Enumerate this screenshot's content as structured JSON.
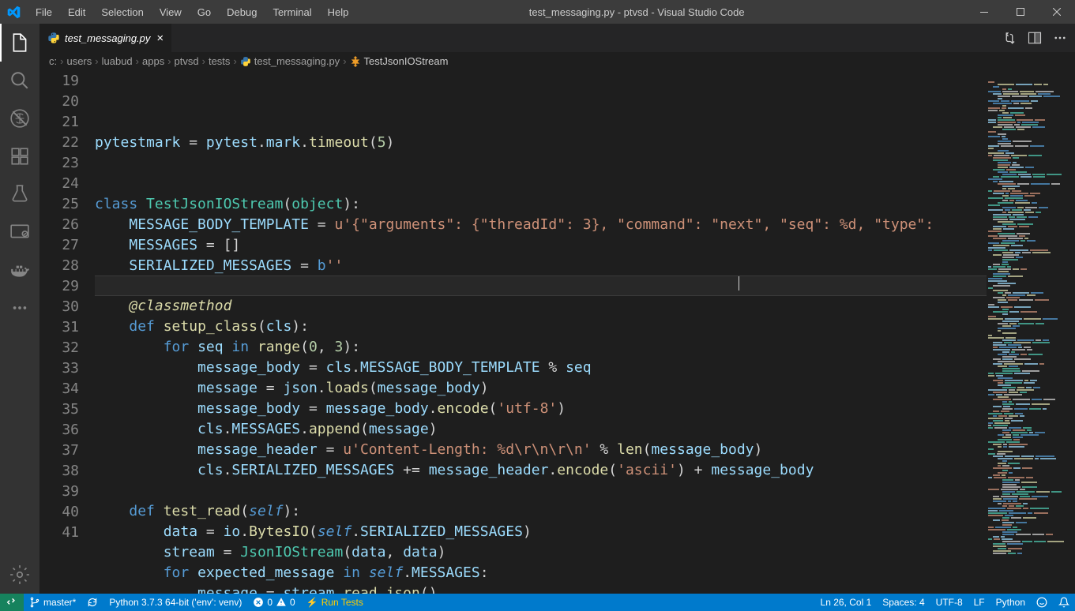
{
  "window": {
    "title": "test_messaging.py - ptvsd - Visual Studio Code"
  },
  "menu": [
    "File",
    "Edit",
    "Selection",
    "View",
    "Go",
    "Debug",
    "Terminal",
    "Help"
  ],
  "tab": {
    "filename": "test_messaging.py"
  },
  "breadcrumbs": [
    {
      "label": "c:"
    },
    {
      "label": "users"
    },
    {
      "label": "luabud"
    },
    {
      "label": "apps"
    },
    {
      "label": "ptvsd"
    },
    {
      "label": "tests"
    },
    {
      "label": "test_messaging.py",
      "icon": "python"
    },
    {
      "label": "TestJsonIOStream",
      "icon": "class"
    }
  ],
  "editor": {
    "lines": [
      {
        "n": 19,
        "html": "<span class='var'>pytestmark</span> <span class='op'>=</span> <span class='var'>pytest</span>.<span class='var'>mark</span>.<span class='fn'>timeout</span>(<span class='num'>5</span>)"
      },
      {
        "n": 20,
        "html": ""
      },
      {
        "n": 21,
        "html": ""
      },
      {
        "n": 22,
        "html": "<span class='kw'>class</span> <span class='cls'>TestJsonIOStream</span>(<span class='cls'>object</span>):"
      },
      {
        "n": 23,
        "html": "    <span class='var'>MESSAGE_BODY_TEMPLATE</span> <span class='op'>=</span> <span class='str'>u'{\"arguments\": {\"threadId\": 3}, \"command\": \"next\", \"seq\": %d, \"type\":</span>"
      },
      {
        "n": 24,
        "html": "    <span class='var'>MESSAGES</span> <span class='op'>=</span> []"
      },
      {
        "n": 25,
        "html": "    <span class='var'>SERIALIZED_MESSAGES</span> <span class='op'>=</span> <span class='kw'>b</span><span class='str'>''</span>"
      },
      {
        "n": 26,
        "html": "",
        "current": true
      },
      {
        "n": 27,
        "html": "    <span class='bfn'>@classmethod</span>"
      },
      {
        "n": 28,
        "html": "    <span class='kw'>def</span> <span class='fn'>setup_class</span>(<span class='var'>cls</span>):"
      },
      {
        "n": 29,
        "html": "        <span class='kw'>for</span> <span class='var'>seq</span> <span class='kw'>in</span> <span class='fn'>range</span>(<span class='num'>0</span>, <span class='num'>3</span>):"
      },
      {
        "n": 30,
        "html": "            <span class='var'>message_body</span> <span class='op'>=</span> <span class='var'>cls</span>.<span class='var'>MESSAGE_BODY_TEMPLATE</span> <span class='op'>%</span> <span class='var'>seq</span>"
      },
      {
        "n": 31,
        "html": "            <span class='var'>message</span> <span class='op'>=</span> <span class='var'>json</span>.<span class='fn'>loads</span>(<span class='var'>message_body</span>)"
      },
      {
        "n": 32,
        "html": "            <span class='var'>message_body</span> <span class='op'>=</span> <span class='var'>message_body</span>.<span class='fn'>encode</span>(<span class='str'>'utf-8'</span>)"
      },
      {
        "n": 33,
        "html": "            <span class='var'>cls</span>.<span class='var'>MESSAGES</span>.<span class='fn'>append</span>(<span class='var'>message</span>)"
      },
      {
        "n": 34,
        "html": "            <span class='var'>message_header</span> <span class='op'>=</span> <span class='str'>u'Content-Length: %d\\r\\n\\r\\n'</span> <span class='op'>%</span> <span class='fn'>len</span>(<span class='var'>message_body</span>)"
      },
      {
        "n": 35,
        "html": "            <span class='var'>cls</span>.<span class='var'>SERIALIZED_MESSAGES</span> <span class='op'>+=</span> <span class='var'>message_header</span>.<span class='fn'>encode</span>(<span class='str'>'ascii'</span>) <span class='op'>+</span> <span class='var'>message_body</span>"
      },
      {
        "n": 36,
        "html": ""
      },
      {
        "n": 37,
        "html": "    <span class='kw'>def</span> <span class='fn'>test_read</span>(<span class='self'>self</span>):"
      },
      {
        "n": 38,
        "html": "        <span class='var'>data</span> <span class='op'>=</span> <span class='var'>io</span>.<span class='fn'>BytesIO</span>(<span class='self'>self</span>.<span class='var'>SERIALIZED_MESSAGES</span>)"
      },
      {
        "n": 39,
        "html": "        <span class='var'>stream</span> <span class='op'>=</span> <span class='cls'>JsonIOStream</span>(<span class='var'>data</span>, <span class='var'>data</span>)"
      },
      {
        "n": 40,
        "html": "        <span class='kw'>for</span> <span class='var'>expected_message</span> <span class='kw'>in</span> <span class='self'>self</span>.<span class='var'>MESSAGES</span>:"
      },
      {
        "n": 41,
        "html": "            <span class='var'>message</span> <span class='op'>=</span> <span class='var'>stream</span>.<span class='fn'>read_json</span>()"
      }
    ]
  },
  "statusbar": {
    "branch": "master*",
    "interpreter": "Python 3.7.3 64-bit ('env': venv)",
    "errors": "0",
    "warnings": "0",
    "runtests": "Run Tests",
    "cursor": "Ln 26, Col 1",
    "spaces": "Spaces: 4",
    "encoding": "UTF-8",
    "eol": "LF",
    "language": "Python"
  }
}
